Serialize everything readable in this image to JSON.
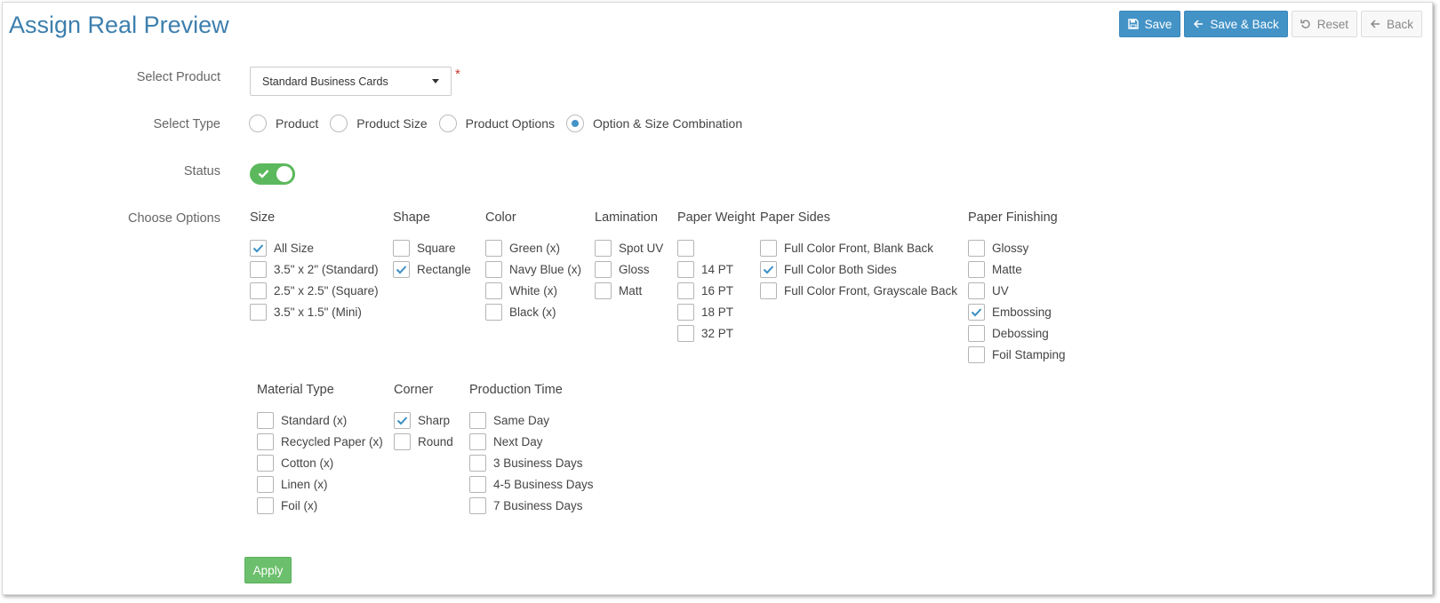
{
  "title": "Assign Real Preview",
  "toolbar": {
    "save_label": "Save",
    "save_back_label": "Save & Back",
    "reset_label": "Reset",
    "back_label": "Back"
  },
  "form": {
    "product_label": "Select Product",
    "product_value": "Standard Business Cards",
    "required_mark": "*",
    "type_label": "Select Type",
    "types": [
      {
        "label": "Product",
        "selected": false
      },
      {
        "label": "Product Size",
        "selected": false
      },
      {
        "label": "Product Options",
        "selected": false
      },
      {
        "label": "Option & Size Combination",
        "selected": true
      }
    ],
    "status_label": "Status",
    "status_on": true,
    "options_label": "Choose Options",
    "apply_label": "Apply"
  },
  "groups": [
    {
      "title": "Size",
      "items": [
        {
          "label": "All Size",
          "checked": true
        },
        {
          "label": "3.5\" x 2\" (Standard)",
          "checked": false
        },
        {
          "label": "2.5\" x 2.5\" (Square)",
          "checked": false
        },
        {
          "label": "3.5\" x 1.5\" (Mini)",
          "checked": false
        }
      ]
    },
    {
      "title": "Shape",
      "items": [
        {
          "label": "Square",
          "checked": false
        },
        {
          "label": "Rectangle",
          "checked": true
        }
      ]
    },
    {
      "title": "Color",
      "items": [
        {
          "label": "Green (x)",
          "checked": false
        },
        {
          "label": "Navy Blue (x)",
          "checked": false
        },
        {
          "label": "White (x)",
          "checked": false
        },
        {
          "label": "Black (x)",
          "checked": false
        }
      ]
    },
    {
      "title": "Lamination",
      "items": [
        {
          "label": "Spot UV",
          "checked": false
        },
        {
          "label": "Gloss",
          "checked": false
        },
        {
          "label": "Matt",
          "checked": false
        }
      ]
    },
    {
      "title": "Paper Weight",
      "items": [
        {
          "label": "",
          "checked": false
        },
        {
          "label": "14 PT",
          "checked": false
        },
        {
          "label": "16 PT",
          "checked": false
        },
        {
          "label": "18 PT",
          "checked": false
        },
        {
          "label": "32 PT",
          "checked": false
        }
      ]
    },
    {
      "title": "Paper Sides",
      "items": [
        {
          "label": "Full Color Front, Blank Back",
          "checked": false
        },
        {
          "label": "Full Color Both Sides",
          "checked": true
        },
        {
          "label": "Full Color Front, Grayscale Back",
          "checked": false
        }
      ]
    },
    {
      "title": "Paper Finishing",
      "items": [
        {
          "label": "Glossy",
          "checked": false
        },
        {
          "label": "Matte",
          "checked": false
        },
        {
          "label": "UV",
          "checked": false
        },
        {
          "label": "Embossing",
          "checked": true
        },
        {
          "label": "Debossing",
          "checked": false
        },
        {
          "label": "Foil Stamping",
          "checked": false
        }
      ]
    },
    {
      "title": "Material Type",
      "items": [
        {
          "label": "Standard (x)",
          "checked": false
        },
        {
          "label": "Recycled Paper (x)",
          "checked": false
        },
        {
          "label": "Cotton (x)",
          "checked": false
        },
        {
          "label": "Linen (x)",
          "checked": false
        },
        {
          "label": "Foil (x)",
          "checked": false
        }
      ]
    },
    {
      "title": "Corner",
      "items": [
        {
          "label": "Sharp",
          "checked": true
        },
        {
          "label": "Round",
          "checked": false
        }
      ]
    },
    {
      "title": "Production Time",
      "items": [
        {
          "label": "Same Day",
          "checked": false
        },
        {
          "label": "Next Day",
          "checked": false
        },
        {
          "label": "3 Business Days",
          "checked": false
        },
        {
          "label": "4-5 Business Days",
          "checked": false
        },
        {
          "label": "7 Business Days",
          "checked": false
        }
      ]
    }
  ],
  "colors": {
    "primary": "#4393c7",
    "title": "#3d7fae",
    "success": "#5cb85c",
    "required": "#c0392b"
  },
  "icons": {
    "save": "floppy-disk-icon",
    "save_back": "arrow-left-icon",
    "reset": "undo-icon",
    "back": "arrow-left-icon",
    "check": "checkmark-icon",
    "dropdown": "caret-down-icon"
  }
}
